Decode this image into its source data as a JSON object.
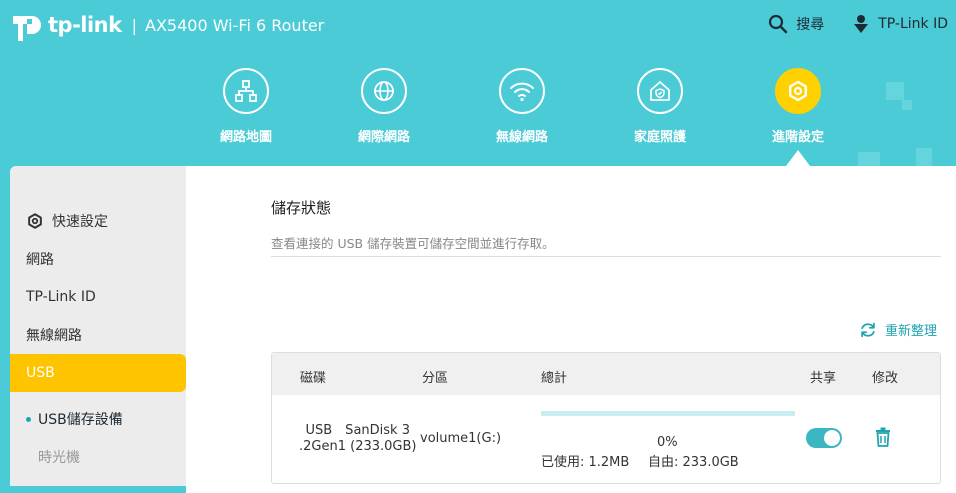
{
  "header": {
    "brand": "tp-link",
    "separator": "|",
    "model": "AX5400 Wi-Fi 6 Router",
    "search_label": "搜尋",
    "account_label": "TP-Link ID"
  },
  "nav": {
    "items": [
      {
        "label": "網路地圖",
        "icon": "network-map-icon"
      },
      {
        "label": "網際網路",
        "icon": "globe-icon"
      },
      {
        "label": "無線網路",
        "icon": "wifi-icon"
      },
      {
        "label": "家庭照護",
        "icon": "home-shield-icon"
      },
      {
        "label": "進階設定",
        "icon": "gear-icon",
        "active": true
      }
    ]
  },
  "sidebar": {
    "items": [
      {
        "label": "快速設定",
        "icon": "gear-icon"
      },
      {
        "label": "網路"
      },
      {
        "label": "TP-Link ID"
      },
      {
        "label": "無線網路"
      },
      {
        "label": "USB",
        "active": true
      }
    ],
    "sub_items": [
      {
        "label": "USB儲存設備",
        "active": true
      },
      {
        "label": "時光機"
      }
    ]
  },
  "storage": {
    "title": "儲存狀態",
    "description": "查看連接的 USB 儲存裝置可儲存空間並進行存取。",
    "refresh_label": "重新整理",
    "columns": [
      "磁碟",
      "分區",
      "總計",
      "共享",
      "修改"
    ],
    "rows": [
      {
        "disk_line1": "USB　SanDisk 3",
        "disk_line2": ".2Gen1 (233.0GB)",
        "partition": "volume1(G:)",
        "usage_percent": "0%",
        "usage_fraction": 0,
        "used": "已使用: 1.2MB",
        "free": "自由: 233.0GB",
        "shared": true
      }
    ]
  },
  "colors": {
    "header_bg": "#4acbd6",
    "accent": "#1fa4b0",
    "active_yellow": "#ffc400"
  }
}
